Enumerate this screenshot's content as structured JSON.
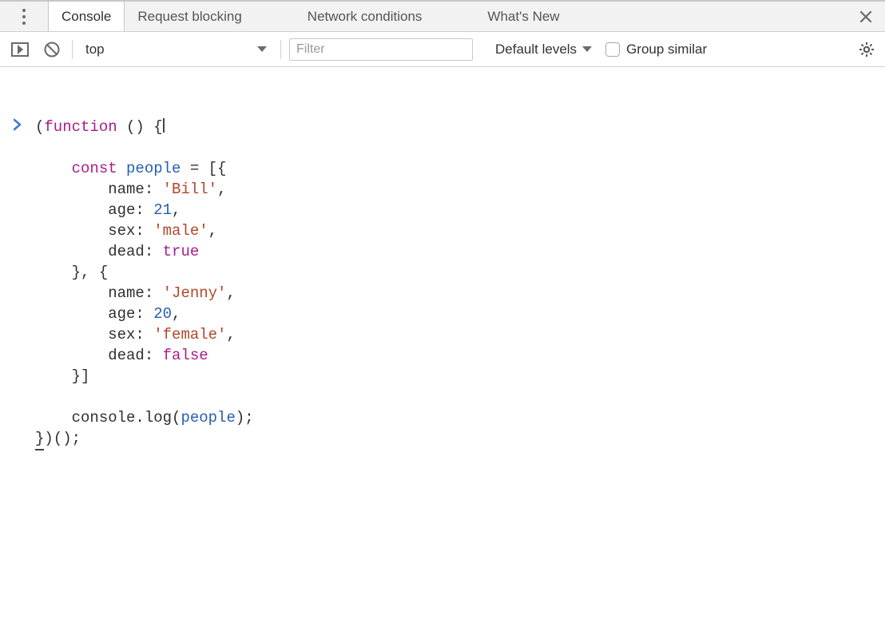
{
  "tabs": {
    "console": "Console",
    "request_blocking": "Request blocking",
    "network_conditions": "Network conditions",
    "whats_new": "What's New"
  },
  "toolbar": {
    "context": "top",
    "filter_placeholder": "Filter",
    "levels_label": "Default levels",
    "group_similar_label": "Group similar"
  },
  "prompt": "›",
  "code": {
    "l1_a": "(",
    "l1_kw": "function",
    "l1_b": " () {",
    "blank1": "",
    "l3_indent": "    ",
    "l3_kw": "const",
    "l3_sp": " ",
    "l3_id": "people",
    "l3_rest": " = [{",
    "l4": "        name: ",
    "l4_str": "'Bill'",
    "l4_end": ",",
    "l5": "        age: ",
    "l5_num": "21",
    "l5_end": ",",
    "l6": "        sex: ",
    "l6_str": "'male'",
    "l6_end": ",",
    "l7": "        dead: ",
    "l7_kw": "true",
    "l8": "    }, {",
    "l9": "        name: ",
    "l9_str": "'Jenny'",
    "l9_end": ",",
    "l10": "        age: ",
    "l10_num": "20",
    "l10_end": ",",
    "l11": "        sex: ",
    "l11_str": "'female'",
    "l11_end": ",",
    "l12": "        dead: ",
    "l12_kw": "false",
    "l13": "    }]",
    "blank2": "",
    "l15a": "    console.log(",
    "l15_id": "people",
    "l15b": ");",
    "l16a": "}",
    "l16b": ")();"
  }
}
